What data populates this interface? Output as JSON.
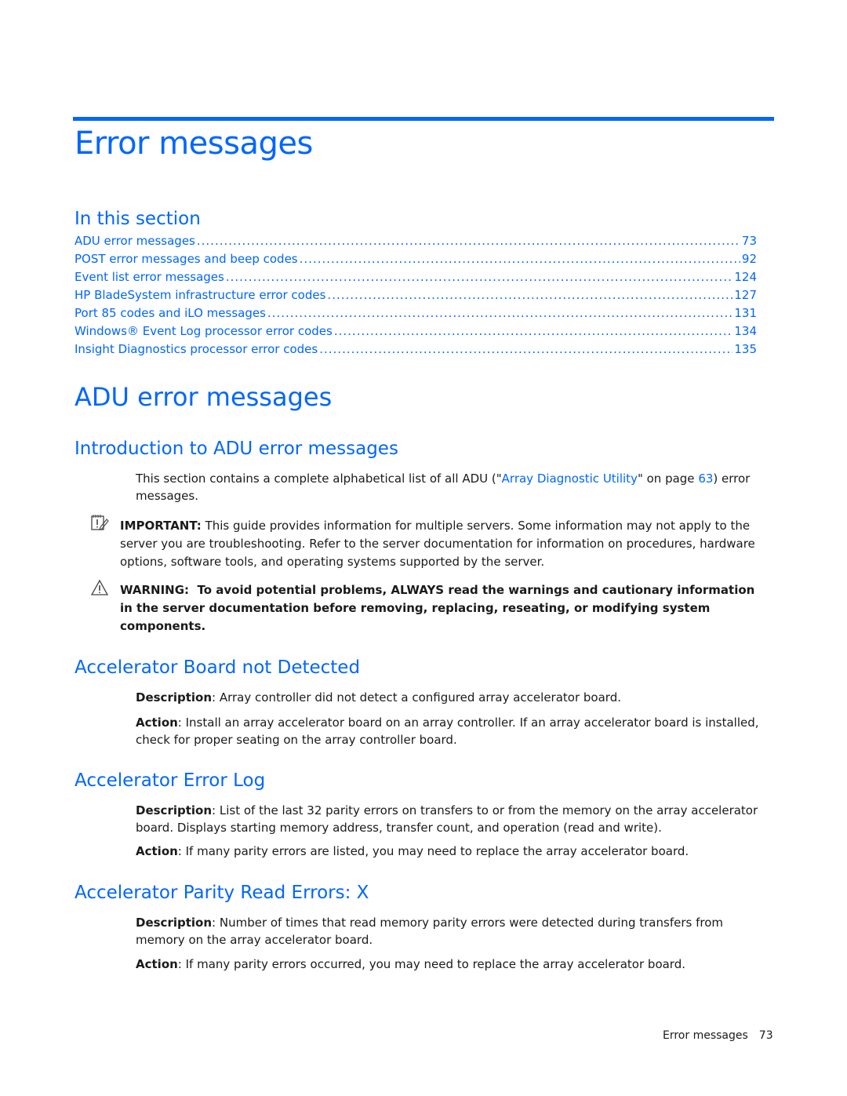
{
  "chapter_title": "Error messages",
  "in_this_section": {
    "heading": "In this section",
    "entries": [
      {
        "label": "ADU error messages",
        "page": "73"
      },
      {
        "label": "POST error messages and beep codes",
        "page": "92"
      },
      {
        "label": "Event list error messages",
        "page": "124"
      },
      {
        "label": "HP BladeSystem infrastructure error codes",
        "page": "127"
      },
      {
        "label": "Port 85 codes and iLO messages",
        "page": "131"
      },
      {
        "label": "Windows® Event Log processor error codes",
        "page": "134"
      },
      {
        "label": "Insight Diagnostics processor error codes",
        "page": "135"
      }
    ]
  },
  "adu_section": {
    "heading": "ADU error messages",
    "intro": {
      "heading": "Introduction to ADU error messages",
      "text_before": "This section contains a complete alphabetical list of all ADU (\"",
      "link_label": "Array Diagnostic Utility",
      "text_middle": "\" on page ",
      "page_link": "63",
      "text_after": ") error messages."
    },
    "important": {
      "icon": "important-notepad-icon",
      "label": "IMPORTANT:",
      "text": "This guide provides information for multiple servers. Some information may not apply to the server you are troubleshooting. Refer to the server documentation for information on procedures, hardware options, software tools, and operating systems supported by the server."
    },
    "warning": {
      "icon": "warning-triangle-icon",
      "label": "WARNING:",
      "text": "To avoid potential problems, ALWAYS read the warnings and cautionary information in the server documentation before removing, replacing, reseating, or modifying system components."
    },
    "messages": [
      {
        "title": "Accelerator Board not Detected",
        "description_label": "Description",
        "description": ": Array controller did not detect a configured array accelerator board.",
        "action_label": "Action",
        "action": ": Install an array accelerator board on an array controller. If an array accelerator board is installed, check for proper seating on the array controller board."
      },
      {
        "title": "Accelerator Error Log",
        "description_label": "Description",
        "description": ": List of the last 32 parity errors on transfers to or from the memory on the array accelerator board. Displays starting memory address, transfer count, and operation (read and write).",
        "action_label": "Action",
        "action": ": If many parity errors are listed, you may need to replace the array accelerator board."
      },
      {
        "title": "Accelerator Parity Read Errors: X",
        "description_label": "Description",
        "description": ": Number of times that read memory parity errors were detected during transfers from memory on the array accelerator board.",
        "action_label": "Action",
        "action": ": If many parity errors occurred, you may need to replace the array accelerator board."
      }
    ]
  },
  "footer": {
    "label": "Error messages",
    "page": "73"
  },
  "colors": {
    "accent": "#0066ff",
    "text": "#1a1a1a"
  }
}
